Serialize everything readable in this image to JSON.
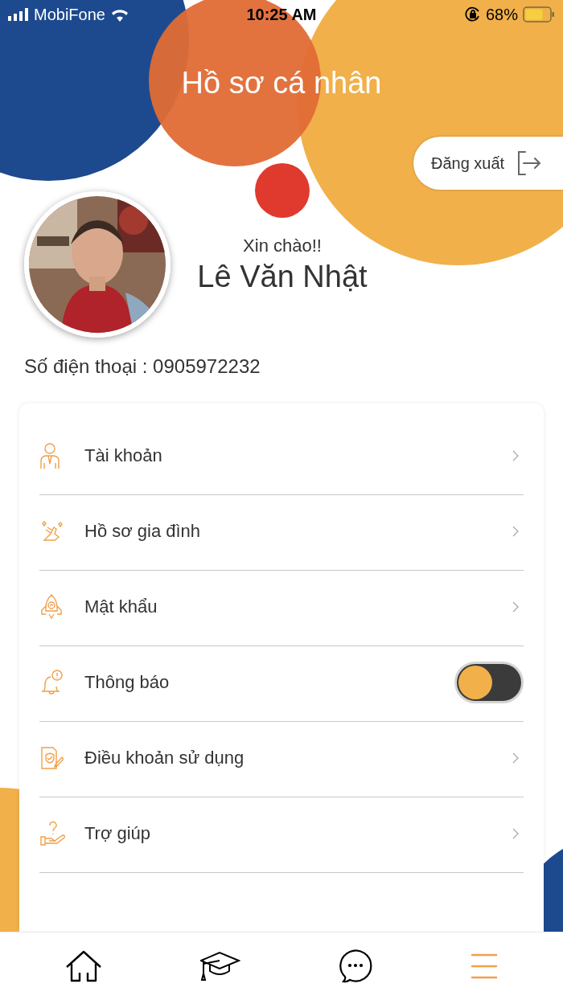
{
  "status_bar": {
    "carrier": "MobiFone",
    "time": "10:25 AM",
    "battery": "68%"
  },
  "title": "Hồ sơ cá nhân",
  "logout_button": "Đăng xuất",
  "profile": {
    "greeting": "Xin chào!!",
    "name": "Lê Văn Nhật",
    "phone": "Số điện thoại : 0905972232"
  },
  "menu": [
    {
      "kind": "link",
      "label": "Tài khoản"
    },
    {
      "kind": "link",
      "label": "Hồ sơ gia đình"
    },
    {
      "kind": "link",
      "label": "Mật khẩu"
    },
    {
      "kind": "toggle",
      "label": "Thông báo",
      "on": false
    },
    {
      "kind": "link",
      "label": "Điều khoản sử dụng"
    },
    {
      "kind": "link",
      "label": "Trợ giúp"
    }
  ],
  "tab_bar": [
    {
      "selected": false
    },
    {
      "selected": false
    },
    {
      "selected": false
    },
    {
      "selected": true
    }
  ]
}
